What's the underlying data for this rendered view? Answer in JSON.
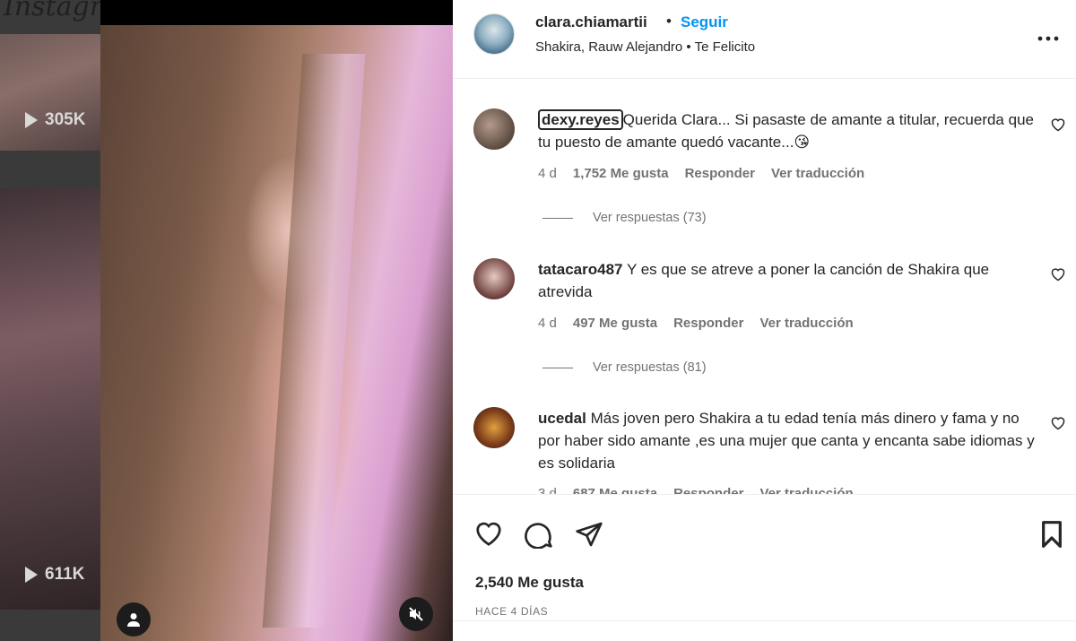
{
  "background_feed": {
    "logo": "Instagram",
    "counts": [
      "305K",
      "611K"
    ]
  },
  "post": {
    "username": "clara.chiamartii",
    "separator": "•",
    "follow_label": "Seguir",
    "audio": "Shakira, Rauw Alejandro • Te Felicito",
    "more_label": "•••"
  },
  "comments": [
    {
      "username": "dexy.reyes",
      "text": "Querida Clara... Si pasaste de amante a titular, recuerda que tu puesto de amante quedó vacante...😘",
      "time": "4 d",
      "likes": "1,752 Me gusta",
      "reply": "Responder",
      "translate": "Ver traducción",
      "replies": "Ver respuestas (73)"
    },
    {
      "username": "tatacaro487",
      "text": "Y es que se atreve a poner la canción de Shakira que atrevida",
      "time": "4 d",
      "likes": "497 Me gusta",
      "reply": "Responder",
      "translate": "Ver traducción",
      "replies": "Ver respuestas (81)"
    },
    {
      "username": "ucedal",
      "text": "Más joven pero Shakira a tu edad tenía más dinero y fama y no por haber sido amante ,es una mujer que canta y encanta sabe idiomas y es solidaria",
      "time": "3 d",
      "likes": "687 Me gusta",
      "reply": "Responder",
      "translate": "Ver traducción"
    }
  ],
  "footer": {
    "likes": "2,540 Me gusta",
    "date": "HACE 4 DÍAS"
  },
  "colors": {
    "accent": "#0095f6",
    "text": "#262626",
    "muted": "#737373"
  }
}
